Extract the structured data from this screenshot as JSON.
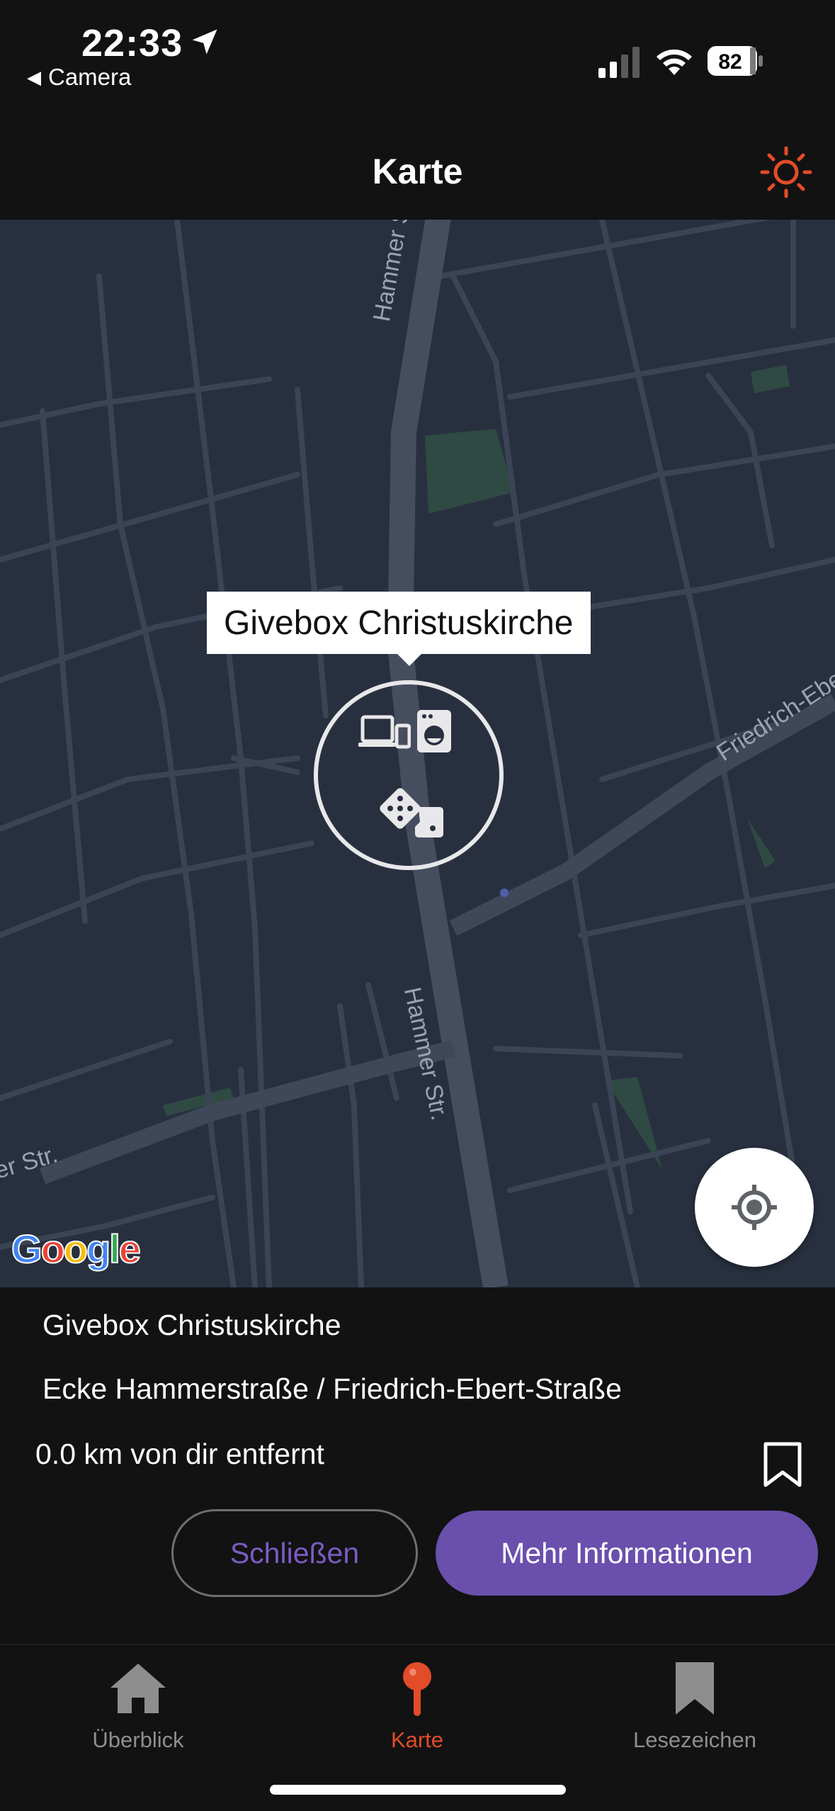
{
  "status_bar": {
    "time": "22:33",
    "back_app": "Camera",
    "battery": "82"
  },
  "header": {
    "title": "Karte",
    "accent_color": "#e24c28"
  },
  "map": {
    "callout": "Givebox Christuskirche",
    "streets": [
      "Hammer Str.",
      "Hammer Str.",
      "Friedrich-Ebert",
      "er Str."
    ],
    "attribution": "Google",
    "marker_icons": [
      "devices-icon",
      "washing-machine-icon",
      "dice-icon"
    ]
  },
  "sheet": {
    "name": "Givebox Christuskirche",
    "address": "Ecke Hammerstraße / Friedrich-Ebert-Straße",
    "distance": "0.0 km von dir entfernt",
    "close_label": "Schließen",
    "more_label": "Mehr Informationen",
    "accent_color": "#6a4fad"
  },
  "tabbar": {
    "tabs": [
      {
        "label": "Überblick",
        "icon": "home-icon",
        "active": false
      },
      {
        "label": "Karte",
        "icon": "map-pin-icon",
        "active": true
      },
      {
        "label": "Lesezeichen",
        "icon": "bookmark-icon",
        "active": false
      }
    ],
    "active_color": "#e24c28",
    "inactive_color": "#8e8e8e"
  }
}
